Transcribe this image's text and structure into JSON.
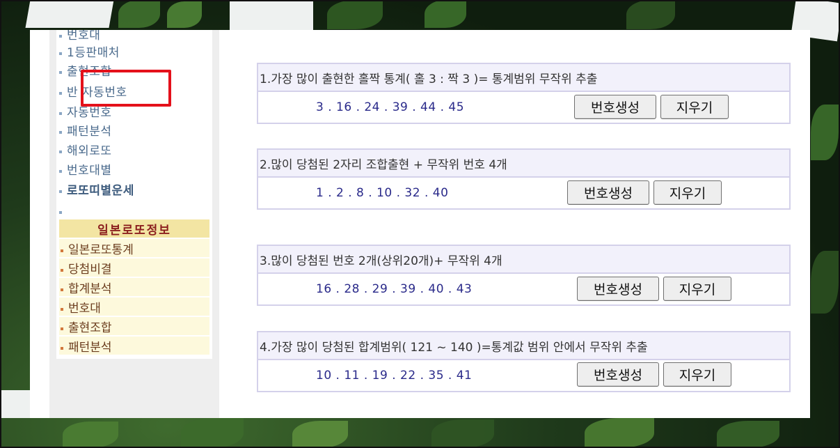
{
  "sidebar": {
    "menu": [
      {
        "label": "번호대"
      },
      {
        "label": "1등판매처"
      },
      {
        "label": "출현조합"
      },
      {
        "label": "반 자동번호"
      },
      {
        "label": "자동번호"
      },
      {
        "label": "패턴분석"
      },
      {
        "label": "해외로또"
      },
      {
        "label": "번호대별"
      },
      {
        "label": "로또띠별운세"
      }
    ],
    "japan_section": {
      "title": "일본로또정보",
      "items": [
        {
          "label": "일본로또통계"
        },
        {
          "label": "당첨비결"
        },
        {
          "label": "합계분석"
        },
        {
          "label": "번호대"
        },
        {
          "label": "출현조합"
        },
        {
          "label": "패턴분석"
        }
      ]
    }
  },
  "boxes": [
    {
      "title": "1.가장 많이 출현한 홀짝 통계( 홀 3 : 짝 3 )= 통계범위 무작위 추출",
      "numbers": "3 . 16 . 24 . 39 . 44 . 45"
    },
    {
      "title": "2.많이 당첨된 2자리 조합출현 + 무작위 번호 4개",
      "numbers": "1 . 2 . 8 . 10 . 32 . 40"
    },
    {
      "title": "3.많이 당첨된 번호 2개(상위20개)+ 무작위 4개",
      "numbers": "16 . 28 . 29 . 39 . 40 . 43"
    },
    {
      "title": "4.가장 많이 당첨된 합계범위( 121 ~ 140 )=통계값 범위 안에서 무작위 추출",
      "numbers": "10 . 11 . 19 . 22 . 35 . 41"
    }
  ],
  "buttons": {
    "generate_label": "번호생성",
    "clear_label": "지우기"
  },
  "colors": {
    "highlight": "#e4111b",
    "section_header_bg": "#f3e5a3",
    "number_text": "#2a2a8a"
  }
}
